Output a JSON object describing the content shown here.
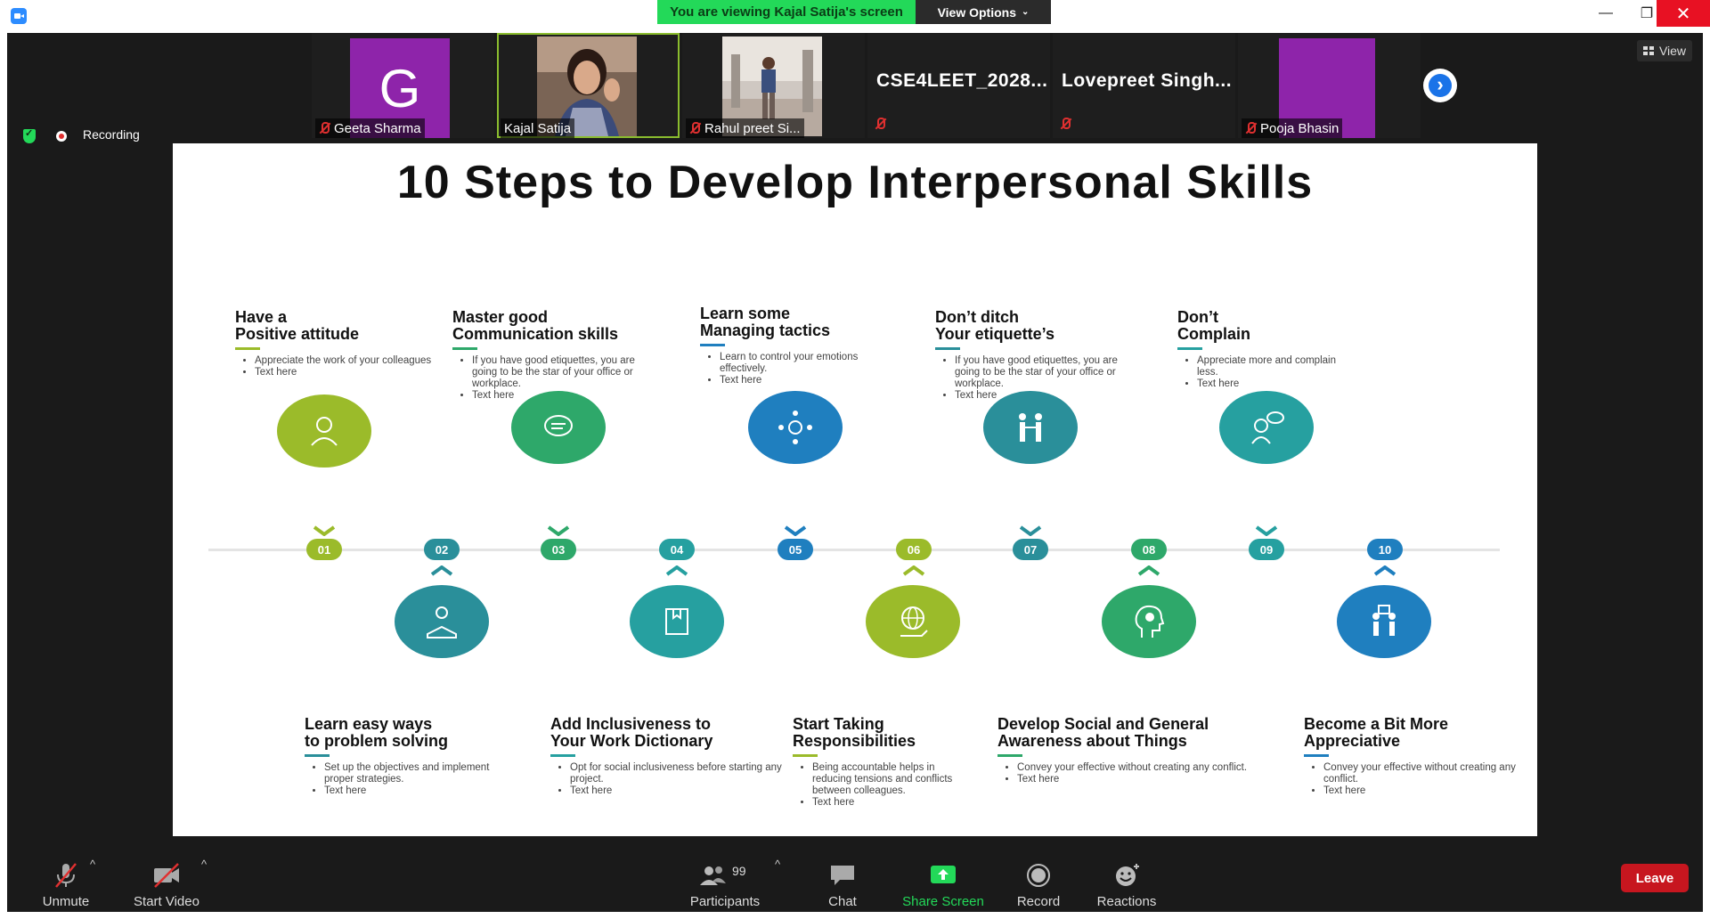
{
  "window": {
    "viewing_banner": "You are viewing Kajal Satija's screen",
    "view_options_label": "View Options",
    "minimize_glyph": "—",
    "maximize_glyph": "❐",
    "close_glyph": "✕"
  },
  "gallery": {
    "participants": [
      {
        "name": "Geeta Sharma",
        "avatar_letter": "G",
        "muted": true
      },
      {
        "name": "Kajal Satija",
        "muted": false,
        "active_speaker": true
      },
      {
        "name": "Rahul preet Si...",
        "muted": true
      },
      {
        "display_name": "CSE4LEET_2028...",
        "muted": true
      },
      {
        "display_name": "Lovepreet  Singh...",
        "muted": true
      },
      {
        "name": "Pooja Bhasin",
        "muted": true
      }
    ],
    "next_glyph": "›",
    "view_label": "View"
  },
  "status": {
    "recording_label": "Recording"
  },
  "slide": {
    "title": "10 Steps to Develop Interpersonal Skills",
    "steps": [
      {
        "number": "01",
        "title_line1": "Have a",
        "title_line2": "Positive attitude",
        "bullets": [
          "Appreciate the work of your colleagues",
          "Text here"
        ],
        "color": "#9bbb2a"
      },
      {
        "number": "02",
        "title_line1": "Learn easy ways",
        "title_line2": "to problem solving",
        "bullets": [
          "Set up the objectives and implement proper strategies.",
          "Text here"
        ],
        "color": "#2a8f9a"
      },
      {
        "number": "03",
        "title_line1": "Master good",
        "title_line2": "Communication skills",
        "bullets": [
          "If you have good etiquettes, you are going to be the star of your office or workplace.",
          "Text here"
        ],
        "color": "#2ea86a"
      },
      {
        "number": "04",
        "title_line1": "Add Inclusiveness to",
        "title_line2": "Your Work Dictionary",
        "bullets": [
          "Opt for social inclusiveness before starting any project.",
          "Text here"
        ],
        "color": "#26a0a0"
      },
      {
        "number": "05",
        "title_line1": "Learn some",
        "title_line2": "Managing tactics",
        "bullets": [
          "Learn to control your emotions effectively.",
          "Text here"
        ],
        "color": "#1f7fbf"
      },
      {
        "number": "06",
        "title_line1": "Start Taking",
        "title_line2": "Responsibilities",
        "bullets": [
          "Being accountable helps in reducing tensions and conflicts between colleagues.",
          "Text here"
        ],
        "color": "#9bbb2a"
      },
      {
        "number": "07",
        "title_line1": "Don’t ditch",
        "title_line2": "Your etiquette’s",
        "bullets": [
          "If you have good etiquettes, you are going to be the star of your office or workplace.",
          "Text here"
        ],
        "color": "#2a8f9a"
      },
      {
        "number": "08",
        "title_line1": "Develop Social and General",
        "title_line2": "Awareness about Things",
        "bullets": [
          "Convey your effective without creating any conflict.",
          "Text here"
        ],
        "color": "#2ea86a"
      },
      {
        "number": "09",
        "title_line1": "Don’t",
        "title_line2": "Complain",
        "bullets": [
          "Appreciate more and complain less.",
          "Text here"
        ],
        "color": "#26a0a0"
      },
      {
        "number": "10",
        "title_line1": "Become a Bit More",
        "title_line2": "Appreciative",
        "bullets": [
          "Convey your effective without creating any conflict.",
          "Text here"
        ],
        "color": "#1f7fbf"
      }
    ]
  },
  "toolbar": {
    "unmute_label": "Unmute",
    "start_video_label": "Start Video",
    "participants_label": "Participants",
    "participants_count": "99",
    "chat_label": "Chat",
    "share_screen_label": "Share Screen",
    "record_label": "Record",
    "reactions_label": "Reactions",
    "leave_label": "Leave",
    "caret_glyph": "^",
    "share_color": "#23D959"
  }
}
